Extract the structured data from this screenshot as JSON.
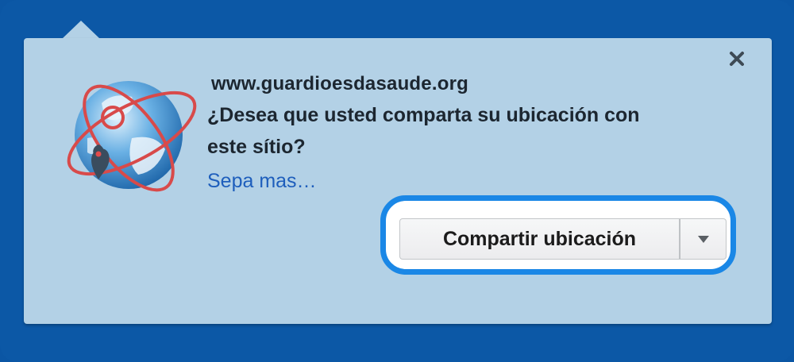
{
  "dialog": {
    "site": "www.guardioesdasaude.org",
    "question": "¿Desea que usted comparta su ubicación con este sítio?",
    "learn_more": "Sepa mas…",
    "share_button": "Compartir ubicación",
    "close_icon": "close-icon",
    "dropdown_icon": "chevron-down-icon",
    "globe_icon": "globe-location-icon"
  },
  "colors": {
    "background": "#0c58a6",
    "panel": "#b3d1e6",
    "link": "#1e5ebc",
    "focus_ring": "#1a87e6",
    "text": "#1c2630"
  }
}
